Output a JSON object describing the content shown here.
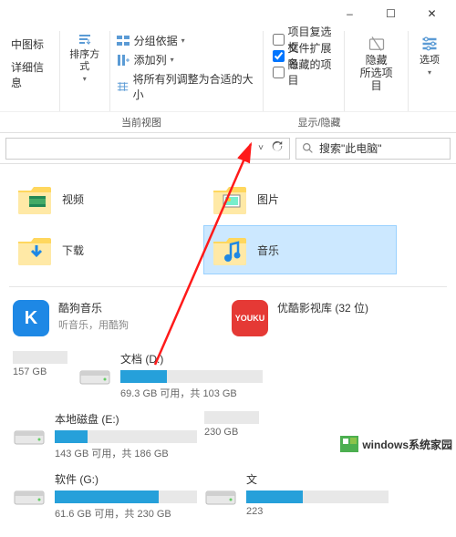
{
  "titlebar": {
    "minimize": "–",
    "maximize": "☐",
    "close": "✕"
  },
  "ribbon": {
    "left": {
      "mediumIcons": "中图标",
      "details": "详细信息"
    },
    "sort": {
      "label": "排序方式"
    },
    "group": {
      "groupBy": "分组依据",
      "addColumn": "添加列",
      "fitColumns": "将所有列调整为合适的大小"
    },
    "checks": {
      "itemCheckbox": "项目复选框",
      "fileExt": "文件扩展名",
      "hiddenItems": "隐藏的项目",
      "extChecked": true
    },
    "hide": {
      "label": "隐藏",
      "sub": "所选项目"
    },
    "options": {
      "label": "选项"
    },
    "sections": {
      "currentView": "当前视图",
      "showHide": "显示/隐藏"
    }
  },
  "search": {
    "placeholder": "搜索\"此电脑\""
  },
  "folders": [
    {
      "name": "视频",
      "overlay": "film"
    },
    {
      "name": "图片",
      "overlay": "photo"
    },
    {
      "name": "下载",
      "overlay": "download"
    },
    {
      "name": "音乐",
      "overlay": "music",
      "selected": true
    }
  ],
  "apps": [
    {
      "icon": "K",
      "bg": "#1e88e5",
      "title": "酷狗音乐",
      "sub": "听音乐，用酷狗"
    },
    {
      "icon": "YOUKU",
      "bg": "#e53935",
      "title": "优酷影视库 (32 位)",
      "sub": ""
    }
  ],
  "drives": [
    {
      "name": "",
      "sub": "157 GB",
      "fill": 0,
      "stub": true
    },
    {
      "name": "文档 (D:)",
      "sub": "69.3 GB 可用，共 103 GB",
      "fill": 33
    },
    {
      "name": "本地磁盘 (E:)",
      "sub": "143 GB 可用，共 186 GB",
      "fill": 23
    },
    {
      "name": "",
      "sub": "230 GB",
      "fill": 0,
      "stub": true
    },
    {
      "name": "软件 (G:)",
      "sub": "61.6 GB 可用，共 230 GB",
      "fill": 73
    },
    {
      "name": "文",
      "sub": "223",
      "fill": 40,
      "cut": true
    }
  ],
  "watermark": "windows系统家园"
}
